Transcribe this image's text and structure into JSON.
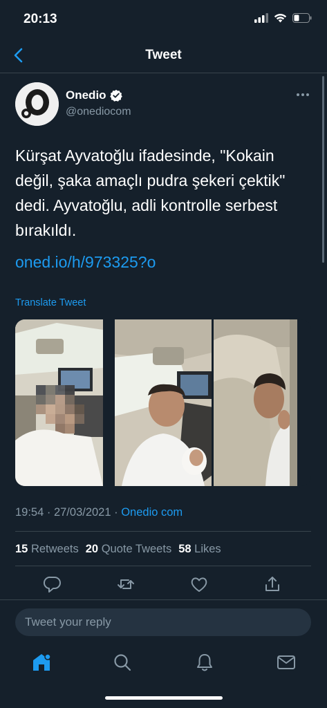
{
  "status_bar": {
    "time": "20:13",
    "icons": [
      "signal-icon",
      "wifi-icon",
      "battery-icon"
    ]
  },
  "nav": {
    "title": "Tweet",
    "back_icon": "back-arrow-icon"
  },
  "tweet": {
    "author_name": "Onedio",
    "author_handle": "@onediocom",
    "verified": true,
    "text": "Kürşat Ayvatoğlu ifadesinde, \"Kokain değil, şaka amaçlı pudra şekeri çektik\" dedi. Ayvatoğlu, adli kontrolle serbest bırakıldı.",
    "link": "oned.io/h/973325?o",
    "translate_label": "Translate Tweet",
    "media_count": 3,
    "timestamp": "19:54 · 27/03/2021 · ",
    "source": "Onedio com"
  },
  "stats": {
    "retweets_count": "15",
    "retweets_label": "Retweets",
    "quotes_count": "20",
    "quotes_label": "Quote Tweets",
    "likes_count": "58",
    "likes_label": "Likes"
  },
  "actions": [
    "reply-icon",
    "retweet-icon",
    "like-icon",
    "share-icon"
  ],
  "reply": {
    "placeholder": "Tweet your reply"
  },
  "tab_bar": {
    "items": [
      "home-icon",
      "search-icon",
      "notifications-icon",
      "messages-icon"
    ],
    "active": "home-icon"
  },
  "colors": {
    "background": "#15202b",
    "accent": "#1d9bf0",
    "secondary_text": "#8899a6",
    "border": "#38444d"
  }
}
